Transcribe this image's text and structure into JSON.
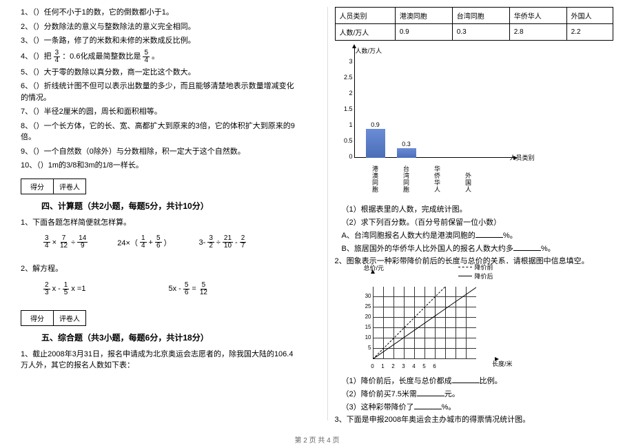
{
  "left": {
    "tf_items": [
      "）任何不小于1的数，它的倒数都小于1。",
      "）分数除法的意义与整数除法的意义完全相同。",
      "）一条路，修了的米数和未修的米数成反比例。",
      "：0.6化成最简整数比是",
      "）大于零的数除以真分数，商一定比这个数大。",
      "）折线统计图不但可以表示出数量的多少，而且能够清楚地表示数量增减变化的情况。",
      "）半径2厘米的圆，周长和面积相等。",
      "）一个长方体，它的长、宽、高都扩大到原来的3倍，它的体积扩大到原来的9倍。",
      "）一个自然数（0除外）与分数相除，积一定大于这个自然数。",
      "）1m的3/8和3m的1/8一样长。"
    ],
    "numbers": [
      "1、（",
      "2、（",
      "3、（",
      "4、（",
      "5、（",
      "6、（",
      "7、（",
      "8、（",
      "9、（",
      "10、（"
    ],
    "tf4_prefix": "）把",
    "tf4_frac1_n": "3",
    "tf4_frac1_d": "4",
    "tf4_frac2_n": "5",
    "tf4_frac2_d": "4",
    "tf4_suffix": "。",
    "score_label1": "得分",
    "score_label2": "评卷人",
    "section4_title": "四、计算题（共2小题，每题5分，共计10分）",
    "calc1_intro": "1、下面各题怎样简便就怎样算。",
    "calc1_a": {
      "f1n": "3",
      "f1d": "4",
      "op1": "×",
      "f2n": "7",
      "f2d": "12",
      "op2": "÷",
      "f3n": "14",
      "f3d": "9"
    },
    "calc1_b_pre": "24×（",
    "calc1_b_f1n": "1",
    "calc1_b_f1d": "4",
    "calc1_b_op": "+",
    "calc1_b_f2n": "5",
    "calc1_b_f2d": "6",
    "calc1_b_post": "）",
    "calc1_c": {
      "pre": "3-",
      "f1n": "3",
      "f1d": "2",
      "op1": "÷",
      "f2n": "21",
      "f2d": "10",
      "op2": "-",
      "f3n": "2",
      "f3d": "7"
    },
    "calc2_intro": "2、解方程。",
    "calc2_a_f1n": "2",
    "calc2_a_f1d": "3",
    "calc2_a_mid": "x -",
    "calc2_a_f2n": "1",
    "calc2_a_f2d": "5",
    "calc2_a_post": "x =1",
    "calc2_b_pre": "5x -",
    "calc2_b_f1n": "5",
    "calc2_b_f1d": "6",
    "calc2_b_eq": "=",
    "calc2_b_f2n": "5",
    "calc2_b_f2d": "12",
    "section5_title": "五、综合题（共3小题，每题6分，共计18分）",
    "comp1": "1、截止2008年3月31日，报名申请成为北京奥运会志愿者的，除我国大陆的106.4万人外，其它的报名人数如下表：",
    "footer": "第 2 页 共 4 页"
  },
  "right": {
    "table_headers": [
      "人员类别",
      "港澳同胞",
      "台湾同胞",
      "华侨华人",
      "外国人"
    ],
    "table_row_label": "人数/万人",
    "table_values": [
      "0.9",
      "0.3",
      "2.8",
      "2.2"
    ],
    "chart": {
      "y_title": "人数/万人",
      "x_title": "人员类别",
      "y_ticks": [
        "0",
        "0.5",
        "1",
        "1.5",
        "2",
        "2.5",
        "3"
      ],
      "categories": [
        "港澳同胞",
        "台湾同胞",
        "华侨华人",
        "外国人"
      ],
      "category_vertical": [
        "港\n澳\n同\n胞",
        "台\n湾\n同\n胞",
        "华\n侨\n华\n人",
        "外\n国\n人"
      ],
      "bar_values": [
        "0.9",
        "0.3"
      ],
      "bar_heights_ratio": [
        0.3,
        0.1
      ]
    },
    "q1_1": "（1）根据表里的人数，完成统计图。",
    "q1_2": "（2）求下列百分数。（百分号前保留一位小数）",
    "q1_2a_pre": "A、台湾同胞报名人数大约是港澳同胞的",
    "q1_2a_suf": "%。",
    "q1_2b_pre": "B、旅居国外的华侨华人比外国人的报名人数大约多",
    "q1_2b_suf": "%。",
    "q2_intro": "2、图象表示一种彩带降价前后的长度与总价的关系．请根据图中信息填空。",
    "legend_before": "降价前",
    "legend_after": "降价后",
    "lc_ylabel": "总价/元",
    "lc_xlabel": "长度/米",
    "lc_x_ticks": [
      "0",
      "1",
      "2",
      "3",
      "4",
      "5",
      "6"
    ],
    "lc_y_ticks": [
      "5",
      "10",
      "15",
      "20",
      "25",
      "30"
    ],
    "q2_1_pre": "（1）降价前后，长度与总价都成",
    "q2_1_suf": "比例。",
    "q2_2_pre": "（2）降价前买7.5米需",
    "q2_2_suf": "元。",
    "q2_3_pre": "（3）这种彩带降价了",
    "q2_3_suf": "%。",
    "q3": "3、下面是申报2008年奥运会主办城市的得票情况统计图。"
  },
  "chart_data": [
    {
      "type": "bar",
      "title": "",
      "xlabel": "人员类别",
      "ylabel": "人数/万人",
      "categories": [
        "港澳同胞",
        "台湾同胞",
        "华侨华人",
        "外国人"
      ],
      "values": [
        0.9,
        0.3,
        null,
        null
      ],
      "ylim": [
        0,
        3
      ],
      "note": "Only first two bars are drawn; remaining to be completed by student"
    },
    {
      "type": "line",
      "title": "彩带降价前后长度与总价关系",
      "xlabel": "长度/米",
      "ylabel": "总价/元",
      "x": [
        0,
        1,
        2,
        3,
        4,
        5,
        6
      ],
      "xlim": [
        0,
        6
      ],
      "ylim": [
        0,
        30
      ],
      "series": [
        {
          "name": "降价前",
          "style": "dashed",
          "values": [
            0,
            5,
            10,
            15,
            20,
            25,
            30
          ]
        },
        {
          "name": "降价后",
          "style": "solid",
          "values": [
            0,
            4,
            8,
            12,
            16,
            20,
            24
          ]
        }
      ]
    }
  ]
}
